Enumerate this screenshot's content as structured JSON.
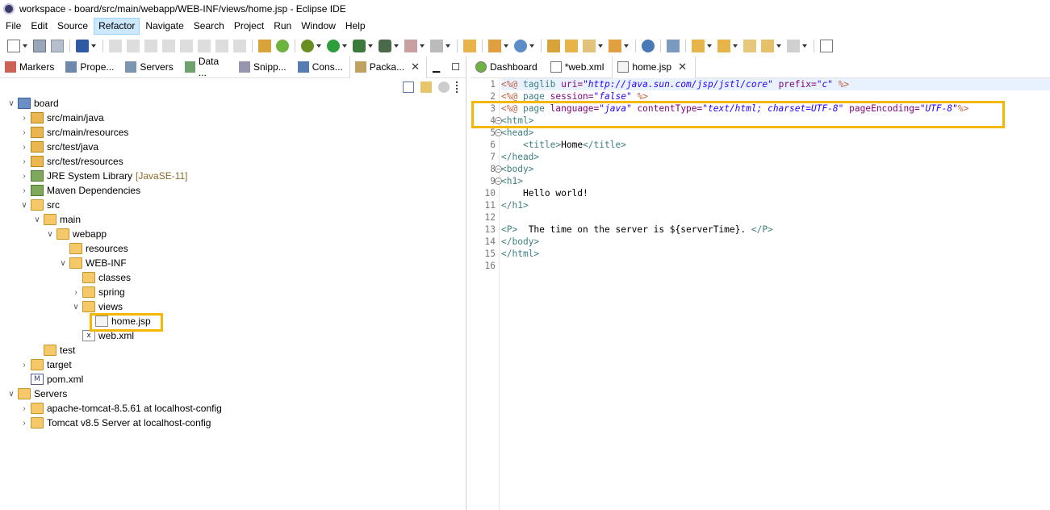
{
  "window": {
    "title": "workspace - board/src/main/webapp/WEB-INF/views/home.jsp - Eclipse IDE"
  },
  "menu": [
    "File",
    "Edit",
    "Source",
    "Refactor",
    "Navigate",
    "Search",
    "Project",
    "Run",
    "Window",
    "Help"
  ],
  "left_tabs": [
    {
      "label": "Markers",
      "icon": "markers-icon"
    },
    {
      "label": "Prope...",
      "icon": "properties-icon"
    },
    {
      "label": "Servers",
      "icon": "servers-icon"
    },
    {
      "label": "Data ...",
      "icon": "data-source-icon"
    },
    {
      "label": "Snipp...",
      "icon": "snippets-icon"
    },
    {
      "label": "Cons...",
      "icon": "console-icon"
    },
    {
      "label": "Packa...",
      "icon": "package-explorer-icon"
    }
  ],
  "tree": [
    {
      "label": "board",
      "depth": 0,
      "arrow": "open",
      "icon": "project"
    },
    {
      "label": "src/main/java",
      "depth": 1,
      "arrow": "closed",
      "icon": "pkgfolder"
    },
    {
      "label": "src/main/resources",
      "depth": 1,
      "arrow": "closed",
      "icon": "pkgfolder"
    },
    {
      "label": "src/test/java",
      "depth": 1,
      "arrow": "closed",
      "icon": "pkgfolder"
    },
    {
      "label": "src/test/resources",
      "depth": 1,
      "arrow": "closed",
      "icon": "pkgfolder"
    },
    {
      "label": "JRE System Library",
      "decor": "[JavaSE-11]",
      "depth": 1,
      "arrow": "closed",
      "icon": "library"
    },
    {
      "label": "Maven Dependencies",
      "depth": 1,
      "arrow": "closed",
      "icon": "library"
    },
    {
      "label": "src",
      "depth": 1,
      "arrow": "open",
      "icon": "folder"
    },
    {
      "label": "main",
      "depth": 2,
      "arrow": "open",
      "icon": "folder"
    },
    {
      "label": "webapp",
      "depth": 3,
      "arrow": "open",
      "icon": "folder"
    },
    {
      "label": "resources",
      "depth": 4,
      "arrow": "none",
      "icon": "folder"
    },
    {
      "label": "WEB-INF",
      "depth": 4,
      "arrow": "open",
      "icon": "folder"
    },
    {
      "label": "classes",
      "depth": 5,
      "arrow": "none",
      "icon": "folder"
    },
    {
      "label": "spring",
      "depth": 5,
      "arrow": "closed",
      "icon": "folder"
    },
    {
      "label": "views",
      "depth": 5,
      "arrow": "open",
      "icon": "folder"
    },
    {
      "label": "home.jsp",
      "depth": 6,
      "arrow": "none",
      "icon": "file"
    },
    {
      "label": "web.xml",
      "depth": 5,
      "arrow": "none",
      "icon": "xmlfile"
    },
    {
      "label": "test",
      "depth": 2,
      "arrow": "none",
      "icon": "folder"
    },
    {
      "label": "target",
      "depth": 1,
      "arrow": "closed",
      "icon": "folder"
    },
    {
      "label": "pom.xml",
      "depth": 1,
      "arrow": "none",
      "icon": "mfile"
    },
    {
      "label": "Servers",
      "depth": 0,
      "arrow": "open",
      "icon": "folder"
    },
    {
      "label": "apache-tomcat-8.5.61 at localhost-config",
      "depth": 1,
      "arrow": "closed",
      "icon": "folder"
    },
    {
      "label": "Tomcat v8.5 Server at localhost-config",
      "depth": 1,
      "arrow": "closed",
      "icon": "folder"
    }
  ],
  "editor_tabs": [
    {
      "label": "Dashboard",
      "icon": "spring-dashboard-icon",
      "active": false
    },
    {
      "label": "*web.xml",
      "icon": "xml-file-icon",
      "active": false
    },
    {
      "label": "home.jsp",
      "icon": "jsp-file-icon",
      "active": true
    }
  ],
  "code_lines": [
    {
      "n": "1",
      "fold": false,
      "parts": [
        [
          "k-dir",
          "<%@ "
        ],
        [
          "k-tag",
          "taglib "
        ],
        [
          "k-attr",
          "uri="
        ],
        [
          "k-val",
          "\"http://java.sun.com/jsp/jstl/core\""
        ],
        [
          "k-text",
          " "
        ],
        [
          "k-attr",
          "prefix="
        ],
        [
          "k-val",
          "\"c\""
        ],
        [
          "k-text",
          " "
        ],
        [
          "k-dir",
          "%>"
        ]
      ]
    },
    {
      "n": "2",
      "fold": false,
      "parts": [
        [
          "k-dir",
          "<%@ "
        ],
        [
          "k-tag",
          "page "
        ],
        [
          "k-attr",
          "session="
        ],
        [
          "k-val",
          "\"false\""
        ],
        [
          "k-text",
          " "
        ],
        [
          "k-dir",
          "%>"
        ]
      ]
    },
    {
      "n": "3",
      "fold": false,
      "parts": [
        [
          "k-dir",
          "<%@ "
        ],
        [
          "k-tag",
          "page "
        ],
        [
          "k-attr",
          "language="
        ],
        [
          "k-val",
          "\"java\""
        ],
        [
          "k-text",
          " "
        ],
        [
          "k-attr",
          "contentType="
        ],
        [
          "k-val",
          "\"text/html; charset=UTF-8\""
        ],
        [
          "k-text",
          " "
        ],
        [
          "k-attr",
          "pageEncoding="
        ],
        [
          "k-val",
          "\"UTF-8\""
        ],
        [
          "k-dir",
          "%>"
        ]
      ]
    },
    {
      "n": "4",
      "fold": true,
      "parts": [
        [
          "k-tag",
          "<html>"
        ]
      ]
    },
    {
      "n": "5",
      "fold": true,
      "parts": [
        [
          "k-tag",
          "<head>"
        ]
      ]
    },
    {
      "n": "6",
      "fold": false,
      "parts": [
        [
          "k-text",
          "    "
        ],
        [
          "k-tag",
          "<title>"
        ],
        [
          "k-text",
          "Home"
        ],
        [
          "k-tag",
          "</title>"
        ]
      ]
    },
    {
      "n": "7",
      "fold": false,
      "parts": [
        [
          "k-tag",
          "</head>"
        ]
      ]
    },
    {
      "n": "8",
      "fold": true,
      "parts": [
        [
          "k-tag",
          "<body>"
        ]
      ]
    },
    {
      "n": "9",
      "fold": true,
      "parts": [
        [
          "k-tag",
          "<h1>"
        ]
      ]
    },
    {
      "n": "10",
      "fold": false,
      "parts": [
        [
          "k-text",
          "    Hello world!"
        ]
      ]
    },
    {
      "n": "11",
      "fold": false,
      "parts": [
        [
          "k-tag",
          "</h1>"
        ]
      ]
    },
    {
      "n": "12",
      "fold": false,
      "parts": []
    },
    {
      "n": "13",
      "fold": false,
      "parts": [
        [
          "k-tag",
          "<P>"
        ],
        [
          "k-text",
          "  The time on the server is ${serverTime}. "
        ],
        [
          "k-tag",
          "</P>"
        ]
      ]
    },
    {
      "n": "14",
      "fold": false,
      "parts": [
        [
          "k-tag",
          "</body>"
        ]
      ]
    },
    {
      "n": "15",
      "fold": false,
      "parts": [
        [
          "k-tag",
          "</html>"
        ]
      ]
    },
    {
      "n": "16",
      "fold": false,
      "parts": []
    }
  ],
  "colors": {
    "highlight_box": "#f5b800",
    "menu_active": "#cce8ff"
  }
}
